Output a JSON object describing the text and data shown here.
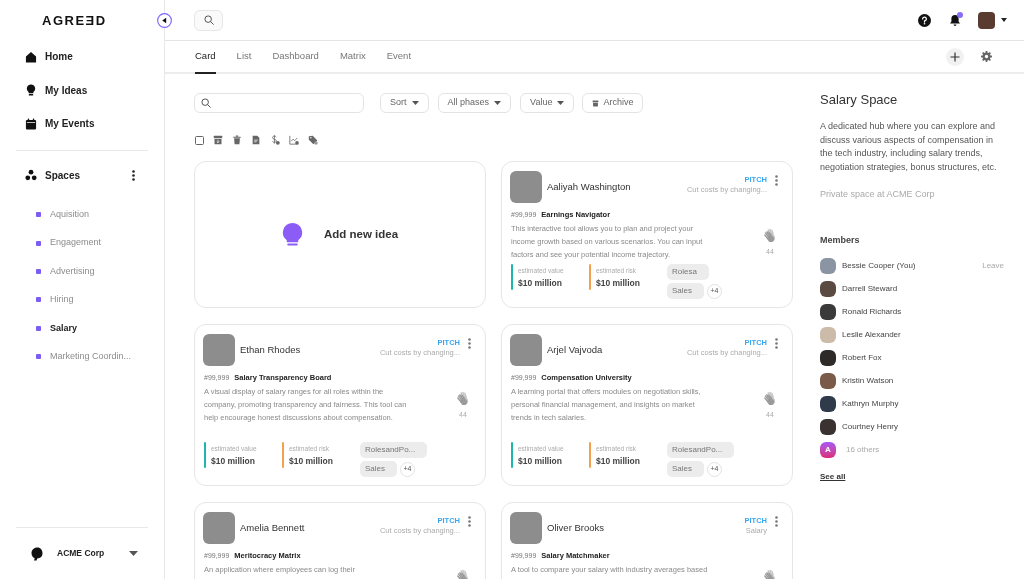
{
  "sidebar": {
    "logo": "AGREƎD",
    "nav": [
      {
        "label": "Home"
      },
      {
        "label": "My Ideas"
      },
      {
        "label": "My Events"
      }
    ],
    "spaces": {
      "title": "Spaces",
      "items": [
        {
          "label": "Aquisition",
          "selected": false
        },
        {
          "label": "Engagement",
          "selected": false
        },
        {
          "label": "Advertising",
          "selected": false
        },
        {
          "label": "Hiring",
          "selected": false
        },
        {
          "label": "Salary",
          "selected": true
        },
        {
          "label": "Marketing Coordin...",
          "selected": false
        }
      ]
    },
    "organization": "ACME Corp"
  },
  "tabs": [
    {
      "label": "Card",
      "selected": true
    },
    {
      "label": "List",
      "selected": false
    },
    {
      "label": "Dashboard",
      "selected": false
    },
    {
      "label": "Matrix",
      "selected": false
    },
    {
      "label": "Event",
      "selected": false
    }
  ],
  "filters": {
    "dropdowns": [
      "Sort",
      "All phases",
      "Value"
    ],
    "archive": "Archive"
  },
  "toolbar": {
    "select_all": {
      "checked": false
    }
  },
  "add_idea": "Add new idea",
  "ideas": [
    {
      "author": "Aaliyah Washington",
      "phase": "PITCH",
      "subtitle": "Cut costs by changing...",
      "number": "#99,999",
      "title": "Earnings Navigator",
      "description": "This interactive tool allows you to plan and project your income growth based on various scenarios. You can input factors and see your potential income trajectory.",
      "claps": "44",
      "metrics": [
        {
          "label": "estimated value",
          "value": "$10 million",
          "color": "#1db6ad"
        },
        {
          "label": "estimated risk",
          "value": "$10 million",
          "color": "#f4a14b"
        }
      ],
      "tags": [
        "Rolesa",
        "Sales"
      ],
      "more_tags": "+4"
    },
    {
      "author": "Ethan Rhodes",
      "phase": "PITCH",
      "subtitle": "Cut costs by changing...",
      "number": "#99,999",
      "title": "Salary Transparency Board",
      "description": "A visual display of salary ranges for all roles within the company, promoting transparency and fairness. This tool can help encourage honest discussions about compensation.",
      "claps": "44",
      "metrics": [
        {
          "label": "estimated value",
          "value": "$10 million",
          "color": "#1db6ad"
        },
        {
          "label": "estimated risk",
          "value": "$10 million",
          "color": "#f4a14b"
        }
      ],
      "tags": [
        "RolesandPo...",
        "Sales"
      ],
      "more_tags": "+4"
    },
    {
      "author": "Arjel Vajvoda",
      "phase": "PITCH",
      "subtitle": "Cut costs by changing...",
      "number": "#99,999",
      "title": "Compensation University",
      "description": "A learning portal that offers modules on negotiation skills, personal financial management, and insights on market trends in tech salaries.",
      "claps": "44",
      "metrics": [
        {
          "label": "estimated value",
          "value": "$10 million",
          "color": "#1db6ad"
        },
        {
          "label": "estimated risk",
          "value": "$10 million",
          "color": "#f4a14b"
        }
      ],
      "tags": [
        "RolesandPo...",
        "Sales"
      ],
      "more_tags": "+4"
    },
    {
      "author": "Amelia Bennett",
      "phase": "PITCH",
      "subtitle": "Cut costs by changing...",
      "number": "#99,999",
      "title": "Meritocracy Matrix",
      "description": "An application where employees can log their"
    },
    {
      "author": "Oliver Brooks",
      "phase": "PITCH",
      "subtitle": "Salary",
      "number": "#99,999",
      "title": "Salary Matchmaker",
      "description": "A tool to compare your salary with industry averages based"
    }
  ],
  "space_panel": {
    "title": "Salary Space",
    "description": "A dedicated hub where you can explore and discuss various aspects of compensation in the tech industry, including salary trends, negotiation strategies, bonus structures, etc.",
    "privacy": "Private space at ACME Corp",
    "members_heading": "Members",
    "members": [
      {
        "name": "Bessie Cooper (You)",
        "action": "Leave"
      },
      {
        "name": "Darrell Steward"
      },
      {
        "name": "Ronald Richards"
      },
      {
        "name": "Leslie Alexander"
      },
      {
        "name": "Robert Fox"
      },
      {
        "name": "Kristin Watson"
      },
      {
        "name": "Kathryn Murphy"
      },
      {
        "name": "Courtney Henry"
      }
    ],
    "others": {
      "initial": "A",
      "label": "16 others"
    },
    "see_all": "See all"
  }
}
